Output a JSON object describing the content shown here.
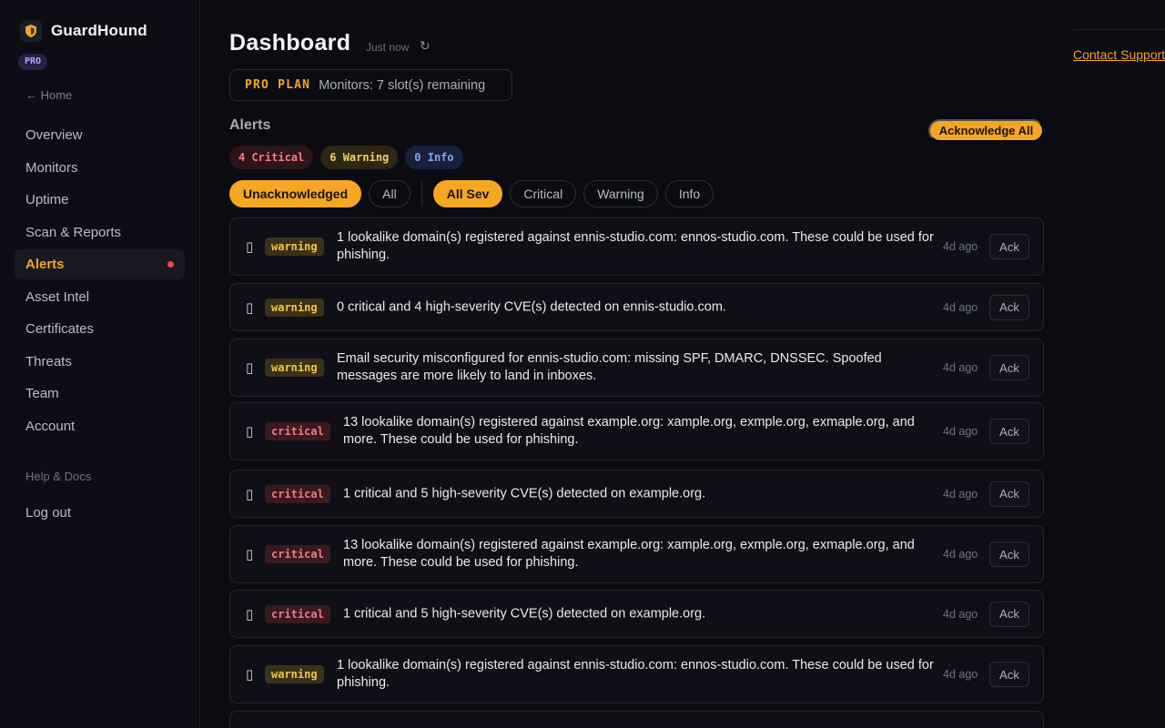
{
  "app": {
    "name": "GuardHound",
    "tier_badge": "PRO",
    "home_link": "← Home"
  },
  "sidebar": {
    "items": [
      {
        "label": "Overview"
      },
      {
        "label": "Monitors"
      },
      {
        "label": "Uptime"
      },
      {
        "label": "Scan & Reports"
      },
      {
        "label": "Alerts",
        "active": true,
        "has_dot": true
      },
      {
        "label": "Asset Intel"
      },
      {
        "label": "Certificates"
      },
      {
        "label": "Threats"
      },
      {
        "label": "Team"
      },
      {
        "label": "Account"
      }
    ],
    "help": "Help & Docs",
    "logout": "Log out"
  },
  "header": {
    "title": "Dashboard",
    "updated": "Just now",
    "refresh_icon": "↻"
  },
  "plan": {
    "label": "PRO PLAN",
    "text": "Monitors: 7 slot(s) remaining"
  },
  "alerts": {
    "heading": "Alerts",
    "ack_all": "Acknowledge All",
    "counts": {
      "critical": "4 Critical",
      "warning": "6 Warning",
      "info": "0 Info"
    },
    "filters": {
      "status": [
        "Unacknowledged",
        "All"
      ],
      "severity": [
        "All Sev",
        "Critical",
        "Warning",
        "Info"
      ],
      "active_status": "Unacknowledged",
      "active_severity": "All Sev"
    },
    "checkbox_glyph": "▯",
    "items": [
      {
        "severity": "warning",
        "message": "1 lookalike domain(s) registered against ennis-studio.com: ennos-studio.com. These could be used for phishing.",
        "ago": "4d ago",
        "ack": "Ack"
      },
      {
        "severity": "warning",
        "message": "0 critical and 4 high-severity CVE(s) detected on ennis-studio.com.",
        "ago": "4d ago",
        "ack": "Ack"
      },
      {
        "severity": "warning",
        "message": "Email security misconfigured for ennis-studio.com: missing SPF, DMARC, DNSSEC. Spoofed messages are more likely to land in inboxes.",
        "ago": "4d ago",
        "ack": "Ack"
      },
      {
        "severity": "critical",
        "message": "13 lookalike domain(s) registered against example.org: xample.org, exmple.org, exmaple.org, and more. These could be used for phishing.",
        "ago": "4d ago",
        "ack": "Ack"
      },
      {
        "severity": "critical",
        "message": "1 critical and 5 high-severity CVE(s) detected on example.org.",
        "ago": "4d ago",
        "ack": "Ack"
      },
      {
        "severity": "critical",
        "message": "13 lookalike domain(s) registered against example.org: xample.org, exmple.org, exmaple.org, and more. These could be used for phishing.",
        "ago": "4d ago",
        "ack": "Ack"
      },
      {
        "severity": "critical",
        "message": "1 critical and 5 high-severity CVE(s) detected on example.org.",
        "ago": "4d ago",
        "ack": "Ack"
      },
      {
        "severity": "warning",
        "message": "1 lookalike domain(s) registered against ennis-studio.com: ennos-studio.com. These could be used for phishing.",
        "ago": "4d ago",
        "ack": "Ack"
      }
    ]
  },
  "right_rail": {
    "contact": "Contact Support"
  },
  "colors": {
    "accent": "#f5a623",
    "critical": "#f07985",
    "warning": "#f3c64a",
    "info": "#7fa6f3",
    "background": "#0b0c12"
  }
}
